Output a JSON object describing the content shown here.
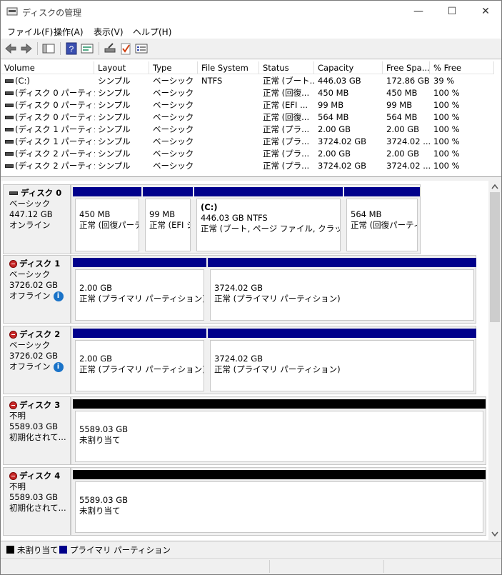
{
  "window": {
    "title": "ディスクの管理",
    "minimize": "—",
    "maximize": "☐",
    "close": "✕"
  },
  "menu": [
    "ファイル(F)",
    "操作(A)",
    "表示(V)",
    "ヘルプ(H)"
  ],
  "toolbar_icons": [
    "back-arrow-icon",
    "forward-arrow-icon",
    "show-hide-tree-icon",
    "help-icon",
    "properties-icon",
    "connect-drive-icon",
    "check-icon",
    "console-icon"
  ],
  "columns": [
    "Volume",
    "Layout",
    "Type",
    "File System",
    "Status",
    "Capacity",
    "Free Spa...",
    "% Free"
  ],
  "volumes": [
    [
      "(C:)",
      "シンプル",
      "ベーシック",
      "NTFS",
      "正常 (ブート...",
      "446.03 GB",
      "172.86 GB",
      "39 %"
    ],
    [
      "(ディスク 0 パーティシ...",
      "シンプル",
      "ベーシック",
      "",
      "正常 (回復...",
      "450 MB",
      "450 MB",
      "100 %"
    ],
    [
      "(ディスク 0 パーティシ...",
      "シンプル",
      "ベーシック",
      "",
      "正常 (EFI ...",
      "99 MB",
      "99 MB",
      "100 %"
    ],
    [
      "(ディスク 0 パーティシ...",
      "シンプル",
      "ベーシック",
      "",
      "正常 (回復...",
      "564 MB",
      "564 MB",
      "100 %"
    ],
    [
      "(ディスク 1 パーティシ...",
      "シンプル",
      "ベーシック",
      "",
      "正常 (プラ...",
      "2.00 GB",
      "2.00 GB",
      "100 %"
    ],
    [
      "(ディスク 1 パーティシ...",
      "シンプル",
      "ベーシック",
      "",
      "正常 (プラ...",
      "3724.02 GB",
      "3724.02 ...",
      "100 %"
    ],
    [
      "(ディスク 2 パーティシ...",
      "シンプル",
      "ベーシック",
      "",
      "正常 (プラ...",
      "2.00 GB",
      "2.00 GB",
      "100 %"
    ],
    [
      "(ディスク 2 パーティシ...",
      "シンプル",
      "ベーシック",
      "",
      "正常 (プラ...",
      "3724.02 GB",
      "3724.02 ...",
      "100 %"
    ]
  ],
  "disks": [
    {
      "name": "ディスク 0",
      "type": "ベーシック",
      "size": "447.12 GB",
      "state": "オンライン",
      "status_icon": "disk-icon",
      "info": false,
      "partitions": [
        {
          "line1": "450 MB",
          "line2": "正常 (回復パーテ",
          "kind": "primary"
        },
        {
          "line1": "99 MB",
          "line2": "正常 (EFI シ",
          "kind": "primary"
        },
        {
          "line0": "(C:)",
          "line1": "446.03 GB NTFS",
          "line2": "正常 (ブート, ページ ファイル, クラッシュ ダン",
          "kind": "primary"
        },
        {
          "line1": "564 MB",
          "line2": "正常 (回復パーティ",
          "kind": "primary"
        }
      ]
    },
    {
      "name": "ディスク 1",
      "type": "ベーシック",
      "size": "3726.02 GB",
      "state": "オフライン",
      "status_icon": "offline-disk-icon",
      "info": true,
      "partitions": [
        {
          "line1": "2.00 GB",
          "line2": "正常 (プライマリ パーティション)",
          "kind": "primary"
        },
        {
          "line1": "3724.02 GB",
          "line2": "正常 (プライマリ パーティション)",
          "kind": "primary"
        }
      ]
    },
    {
      "name": "ディスク 2",
      "type": "ベーシック",
      "size": "3726.02 GB",
      "state": "オフライン",
      "status_icon": "offline-disk-icon",
      "info": true,
      "partitions": [
        {
          "line1": "2.00 GB",
          "line2": "正常 (プライマリ パーティション)",
          "kind": "primary"
        },
        {
          "line1": "3724.02 GB",
          "line2": "正常 (プライマリ パーティション)",
          "kind": "primary"
        }
      ]
    },
    {
      "name": "ディスク 3",
      "type": "不明",
      "size": "5589.03 GB",
      "state": "初期化されて...",
      "status_icon": "offline-disk-icon",
      "info": false,
      "partitions": [
        {
          "line1": "5589.03 GB",
          "line2": "未割り当て",
          "kind": "unalloc"
        }
      ]
    },
    {
      "name": "ディスク 4",
      "type": "不明",
      "size": "5589.03 GB",
      "state": "初期化されて...",
      "status_icon": "offline-disk-icon",
      "info": false,
      "partitions": [
        {
          "line1": "5589.03 GB",
          "line2": "未割り当て",
          "kind": "unalloc"
        }
      ]
    }
  ],
  "legend": [
    {
      "label": "未割り当て",
      "color": "#000000"
    },
    {
      "label": "プライマリ パーティション",
      "color": "#00008b"
    }
  ],
  "colors": {
    "primary": "#00008b",
    "unallocated": "#000000",
    "info": "#1a73c8",
    "offline": "#c62828"
  }
}
